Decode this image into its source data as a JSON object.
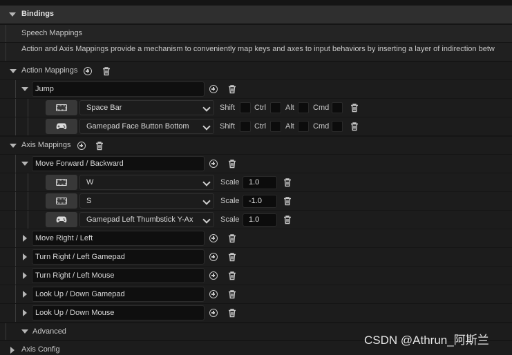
{
  "section": {
    "title": "Bindings"
  },
  "speech": {
    "label": "Speech Mappings"
  },
  "description": "Action and Axis Mappings provide a mechanism to conveniently map keys and axes to input behaviors by inserting a layer of indirection betw",
  "action_mappings": {
    "header": "Action Mappings",
    "groups": [
      {
        "name": "Jump",
        "keys": [
          {
            "device_icon": "keyboard-icon",
            "key": "Space Bar",
            "shift_label": "Shift",
            "ctrl_label": "Ctrl",
            "alt_label": "Alt",
            "cmd_label": "Cmd"
          },
          {
            "device_icon": "gamepad-icon",
            "key": "Gamepad Face Button Bottom",
            "shift_label": "Shift",
            "ctrl_label": "Ctrl",
            "alt_label": "Alt",
            "cmd_label": "Cmd"
          }
        ]
      }
    ]
  },
  "axis_mappings": {
    "header": "Axis Mappings",
    "scale_label": "Scale",
    "groups": [
      {
        "name": "Move Forward / Backward",
        "keys": [
          {
            "device_icon": "keyboard-icon",
            "key": "W",
            "scale": "1.0"
          },
          {
            "device_icon": "keyboard-icon",
            "key": "S",
            "scale": "-1.0"
          },
          {
            "device_icon": "gamepad-icon",
            "key": "Gamepad Left Thumbstick Y-Ax",
            "scale": "1.0"
          }
        ]
      },
      {
        "name": "Move Right / Left"
      },
      {
        "name": "Turn Right / Left Gamepad"
      },
      {
        "name": "Turn Right / Left Mouse"
      },
      {
        "name": "Look Up / Down Gamepad"
      },
      {
        "name": "Look Up / Down Mouse"
      }
    ]
  },
  "advanced": {
    "label": "Advanced"
  },
  "axis_config": {
    "label": "Axis Config"
  },
  "watermark": "CSDN @Athrun_阿斯兰",
  "colors": {
    "panel_bg": "#151515",
    "field_bg": "#0f0f0f",
    "device_btn": "#383838"
  }
}
